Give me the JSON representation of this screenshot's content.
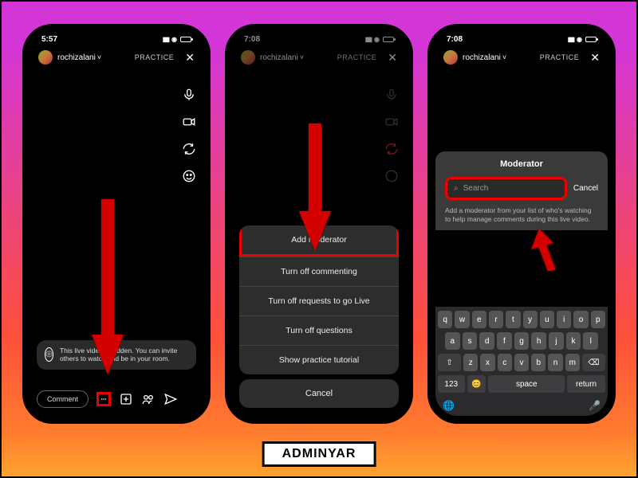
{
  "brand": "ADMINYAR",
  "phone1": {
    "time": "5:57",
    "username": "rochizalani",
    "badge": "PRACTICE",
    "hint_text": "This live video is hidden. You can invite others to watch and be in your room.",
    "comment_placeholder": "Comment"
  },
  "phone2": {
    "time": "7:08",
    "username": "rochizalani",
    "badge": "PRACTICE",
    "sheet": {
      "add_moderator": "Add moderator",
      "turn_off_commenting": "Turn off commenting",
      "turn_off_requests": "Turn off requests to go Live",
      "turn_off_questions": "Turn off questions",
      "show_tutorial": "Show practice tutorial",
      "cancel": "Cancel"
    }
  },
  "phone3": {
    "time": "7:08",
    "username": "rochizalani",
    "badge": "PRACTICE",
    "panel": {
      "title": "Moderator",
      "search_placeholder": "Search",
      "cancel": "Cancel",
      "description": "Add a moderator from your list of who's watching to help manage comments during this live video."
    },
    "keyboard": {
      "row1": [
        "q",
        "w",
        "e",
        "r",
        "t",
        "y",
        "u",
        "i",
        "o",
        "p"
      ],
      "row2": [
        "a",
        "s",
        "d",
        "f",
        "g",
        "h",
        "j",
        "k",
        "l"
      ],
      "row3": [
        "z",
        "x",
        "c",
        "v",
        "b",
        "n",
        "m"
      ],
      "shift": "⇧",
      "backspace": "⌫",
      "numbers": "123",
      "emoji": "😊",
      "space": "space",
      "return": "return",
      "globe": "🌐",
      "mic": "🎤"
    }
  }
}
